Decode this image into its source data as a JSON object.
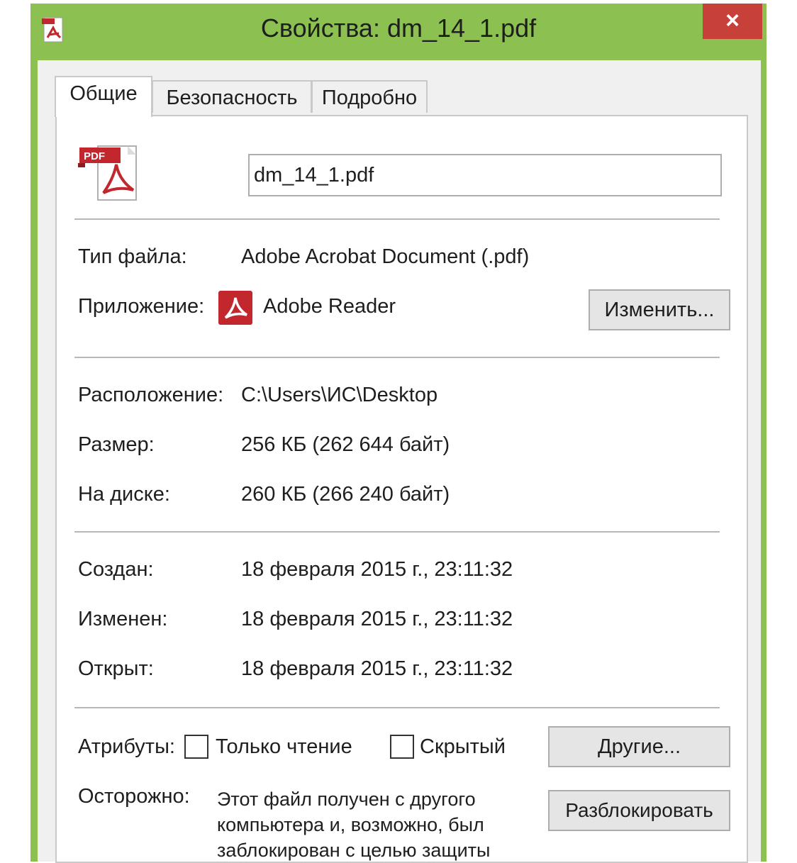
{
  "window": {
    "title": "Свойства: dm_14_1.pdf",
    "close_glyph": "×"
  },
  "tabs": [
    {
      "label": "Общие",
      "active": true
    },
    {
      "label": "Безопасность",
      "active": false
    },
    {
      "label": "Подробно",
      "active": false
    }
  ],
  "file": {
    "icon": "pdf-file-icon",
    "name": "dm_14_1.pdf"
  },
  "info": {
    "type_label": "Тип файла:",
    "type_value": "Adobe Acrobat Document (.pdf)",
    "app_label": "Приложение:",
    "app_value": "Adobe Reader",
    "change_button": "Изменить...",
    "location_label": "Расположение:",
    "location_value": "C:\\Users\\ИС\\Desktop",
    "size_label": "Размер:",
    "size_value": "256 КБ (262 644 байт)",
    "disk_label": "На диске:",
    "disk_value": "260 КБ (266 240 байт)",
    "created_label": "Создан:",
    "created_value": "18 февраля 2015 г., 23:11:32",
    "modified_label": "Изменен:",
    "modified_value": "18 февраля 2015 г., 23:11:32",
    "opened_label": "Открыт:",
    "opened_value": "18 февраля 2015 г., 23:11:32"
  },
  "attributes": {
    "label": "Атрибуты:",
    "readonly_label": "Только чтение",
    "readonly_checked": false,
    "hidden_label": "Скрытый",
    "hidden_checked": false,
    "other_button": "Другие..."
  },
  "warning": {
    "label": "Осторожно:",
    "text": "Этот файл получен с другого компьютера и, возможно, был заблокирован с целью защиты",
    "unblock_button": "Разблокировать"
  },
  "colors": {
    "titlebar": "#8cc152",
    "close": "#c7403a",
    "pdf_red": "#c1272d"
  }
}
